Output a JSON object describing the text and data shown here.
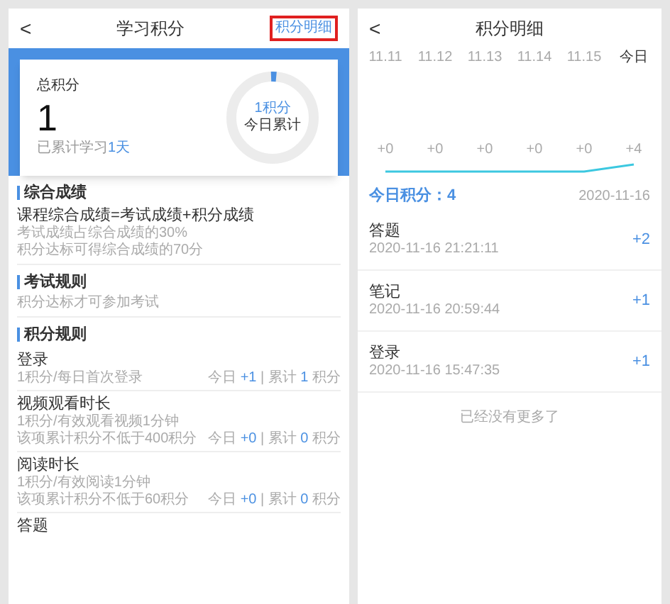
{
  "left": {
    "title": "学习积分",
    "back": "<",
    "detail_link": "积分明细",
    "summary": {
      "label": "总积分",
      "total": "1",
      "studied_prefix": "已累计学习",
      "studied_days": "1天",
      "ring": {
        "level": 0.02,
        "value": "1积分",
        "caption": "今日累计"
      }
    },
    "sections": [
      {
        "title": "综合成绩",
        "items": [
          {
            "kind": "formula",
            "name": "课程综合成绩=考试成绩+积分成绩",
            "notes": [
              "考试成绩占综合成绩的30%",
              "积分达标可得综合成绩的70分"
            ]
          }
        ]
      },
      {
        "title": "考试规则",
        "items": [
          {
            "kind": "note",
            "notes": [
              "积分达标才可参加考试"
            ]
          }
        ]
      },
      {
        "title": "积分规则",
        "items": [
          {
            "kind": "rule",
            "name": "登录",
            "notes": [
              "1积分/每日首次登录"
            ],
            "today_label": "今日",
            "today": "+1",
            "separator": "|",
            "total_label": "累计",
            "total": "1",
            "unit": "积分"
          },
          {
            "kind": "rule",
            "name": "视频观看时长",
            "notes": [
              "1积分/有效观看视频1分钟",
              "该项累计积分不低于400积分"
            ],
            "today_label": "今日",
            "today": "+0",
            "separator": "|",
            "total_label": "累计",
            "total": "0",
            "unit": "积分"
          },
          {
            "kind": "rule",
            "name": "阅读时长",
            "notes": [
              "1积分/有效阅读1分钟",
              "该项累计积分不低于60积分"
            ],
            "today_label": "今日",
            "today": "+0",
            "separator": "|",
            "total_label": "累计",
            "total": "0",
            "unit": "积分"
          },
          {
            "kind": "rule",
            "name": "答题"
          }
        ]
      }
    ]
  },
  "right": {
    "title": "积分明细",
    "back": "<",
    "days": [
      {
        "date": "11.11",
        "gain": "+0",
        "selected": false
      },
      {
        "date": "11.12",
        "gain": "+0",
        "selected": false
      },
      {
        "date": "11.13",
        "gain": "+0",
        "selected": false
      },
      {
        "date": "11.14",
        "gain": "+0",
        "selected": false
      },
      {
        "date": "11.15",
        "gain": "+0",
        "selected": false
      },
      {
        "date": "今日",
        "gain": "+4",
        "selected": true
      }
    ],
    "today_label": "今日积分：",
    "today_value": "4",
    "date": "2020-11-16",
    "records": [
      {
        "name": "答题",
        "time": "2020-11-16 21:21:11",
        "points": "+2"
      },
      {
        "name": "笔记",
        "time": "2020-11-16 20:59:44",
        "points": "+1"
      },
      {
        "name": "登录",
        "time": "2020-11-16 15:47:35",
        "points": "+1"
      }
    ],
    "end_note": "已经没有更多了"
  }
}
